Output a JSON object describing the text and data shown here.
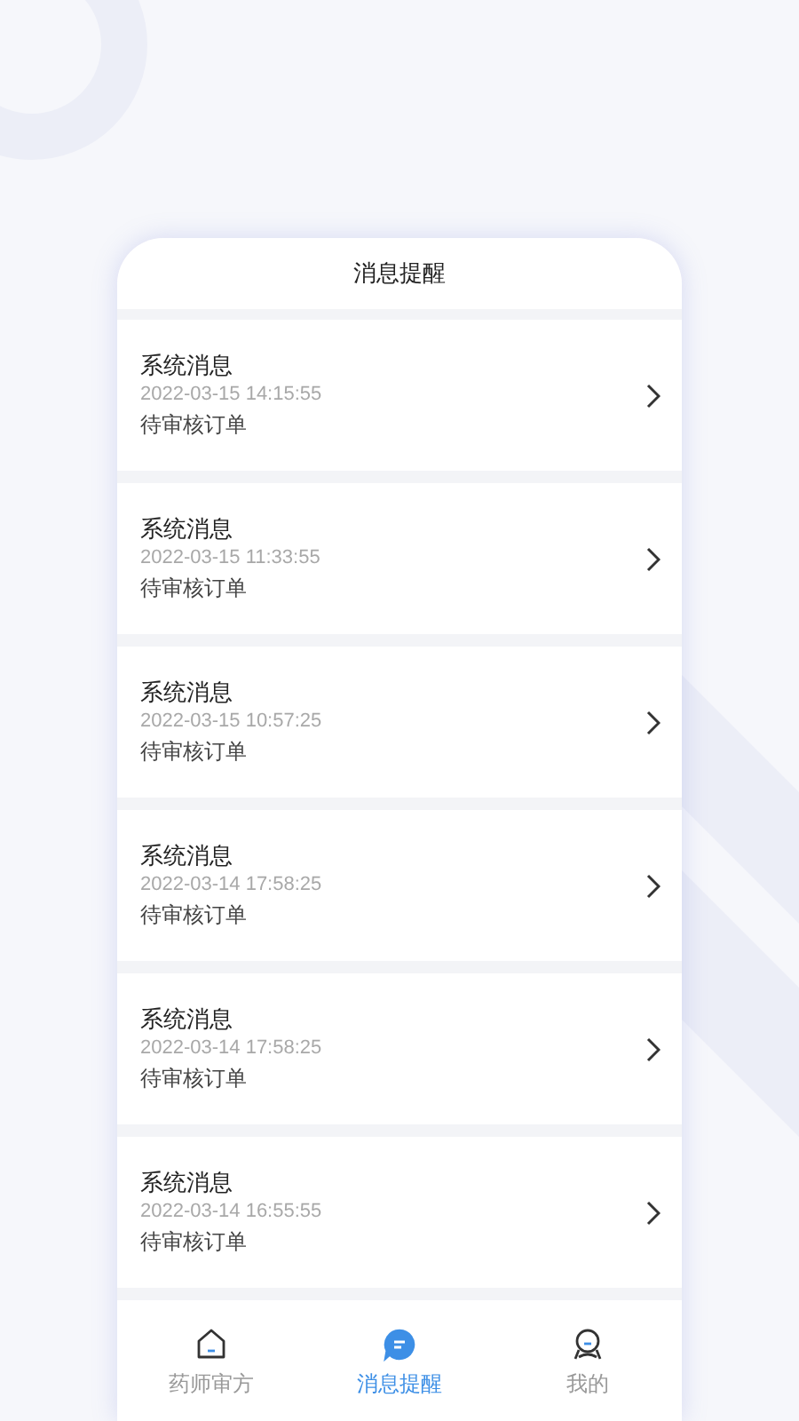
{
  "header": {
    "title": "消息提醒"
  },
  "messages": [
    {
      "title": "系统消息",
      "time": "2022-03-15 14:15:55",
      "body": "待审核订单"
    },
    {
      "title": "系统消息",
      "time": "2022-03-15 11:33:55",
      "body": "待审核订单"
    },
    {
      "title": "系统消息",
      "time": "2022-03-15 10:57:25",
      "body": "待审核订单"
    },
    {
      "title": "系统消息",
      "time": "2022-03-14 17:58:25",
      "body": "待审核订单"
    },
    {
      "title": "系统消息",
      "time": "2022-03-14 17:58:25",
      "body": "待审核订单"
    },
    {
      "title": "系统消息",
      "time": "2022-03-14 16:55:55",
      "body": "待审核订单"
    }
  ],
  "tab_bar": [
    {
      "kind": "home",
      "label": "药师审方",
      "selected": false
    },
    {
      "kind": "message",
      "label": "消息提醒",
      "selected": true
    },
    {
      "kind": "profile",
      "label": "我的",
      "selected": false
    }
  ]
}
